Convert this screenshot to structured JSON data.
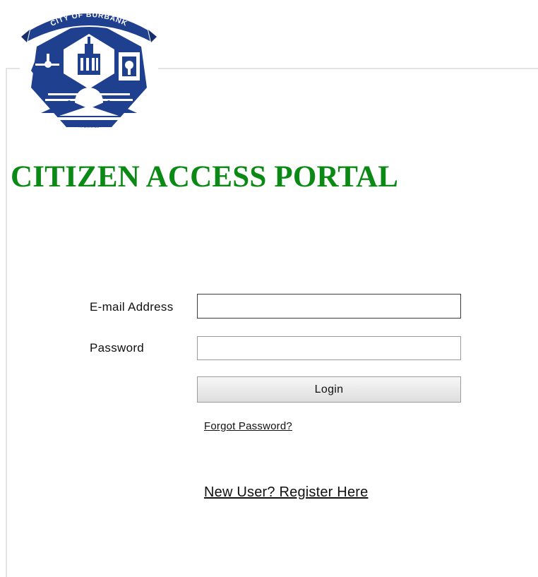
{
  "logo": {
    "banner_text": "CITY OF BURBANK",
    "bottom_text": "INCORPORATED 1911"
  },
  "header": {
    "title": "CITIZEN ACCESS PORTAL"
  },
  "login_form": {
    "email_label": "E-mail Address",
    "email_value": "",
    "password_label": "Password",
    "password_value": "",
    "login_button_label": "Login",
    "forgot_password_link": "Forgot Password?",
    "register_link": "New User? Register Here"
  },
  "colors": {
    "title_green": "#0a8a14",
    "seal_blue": "#1f3f8f"
  }
}
